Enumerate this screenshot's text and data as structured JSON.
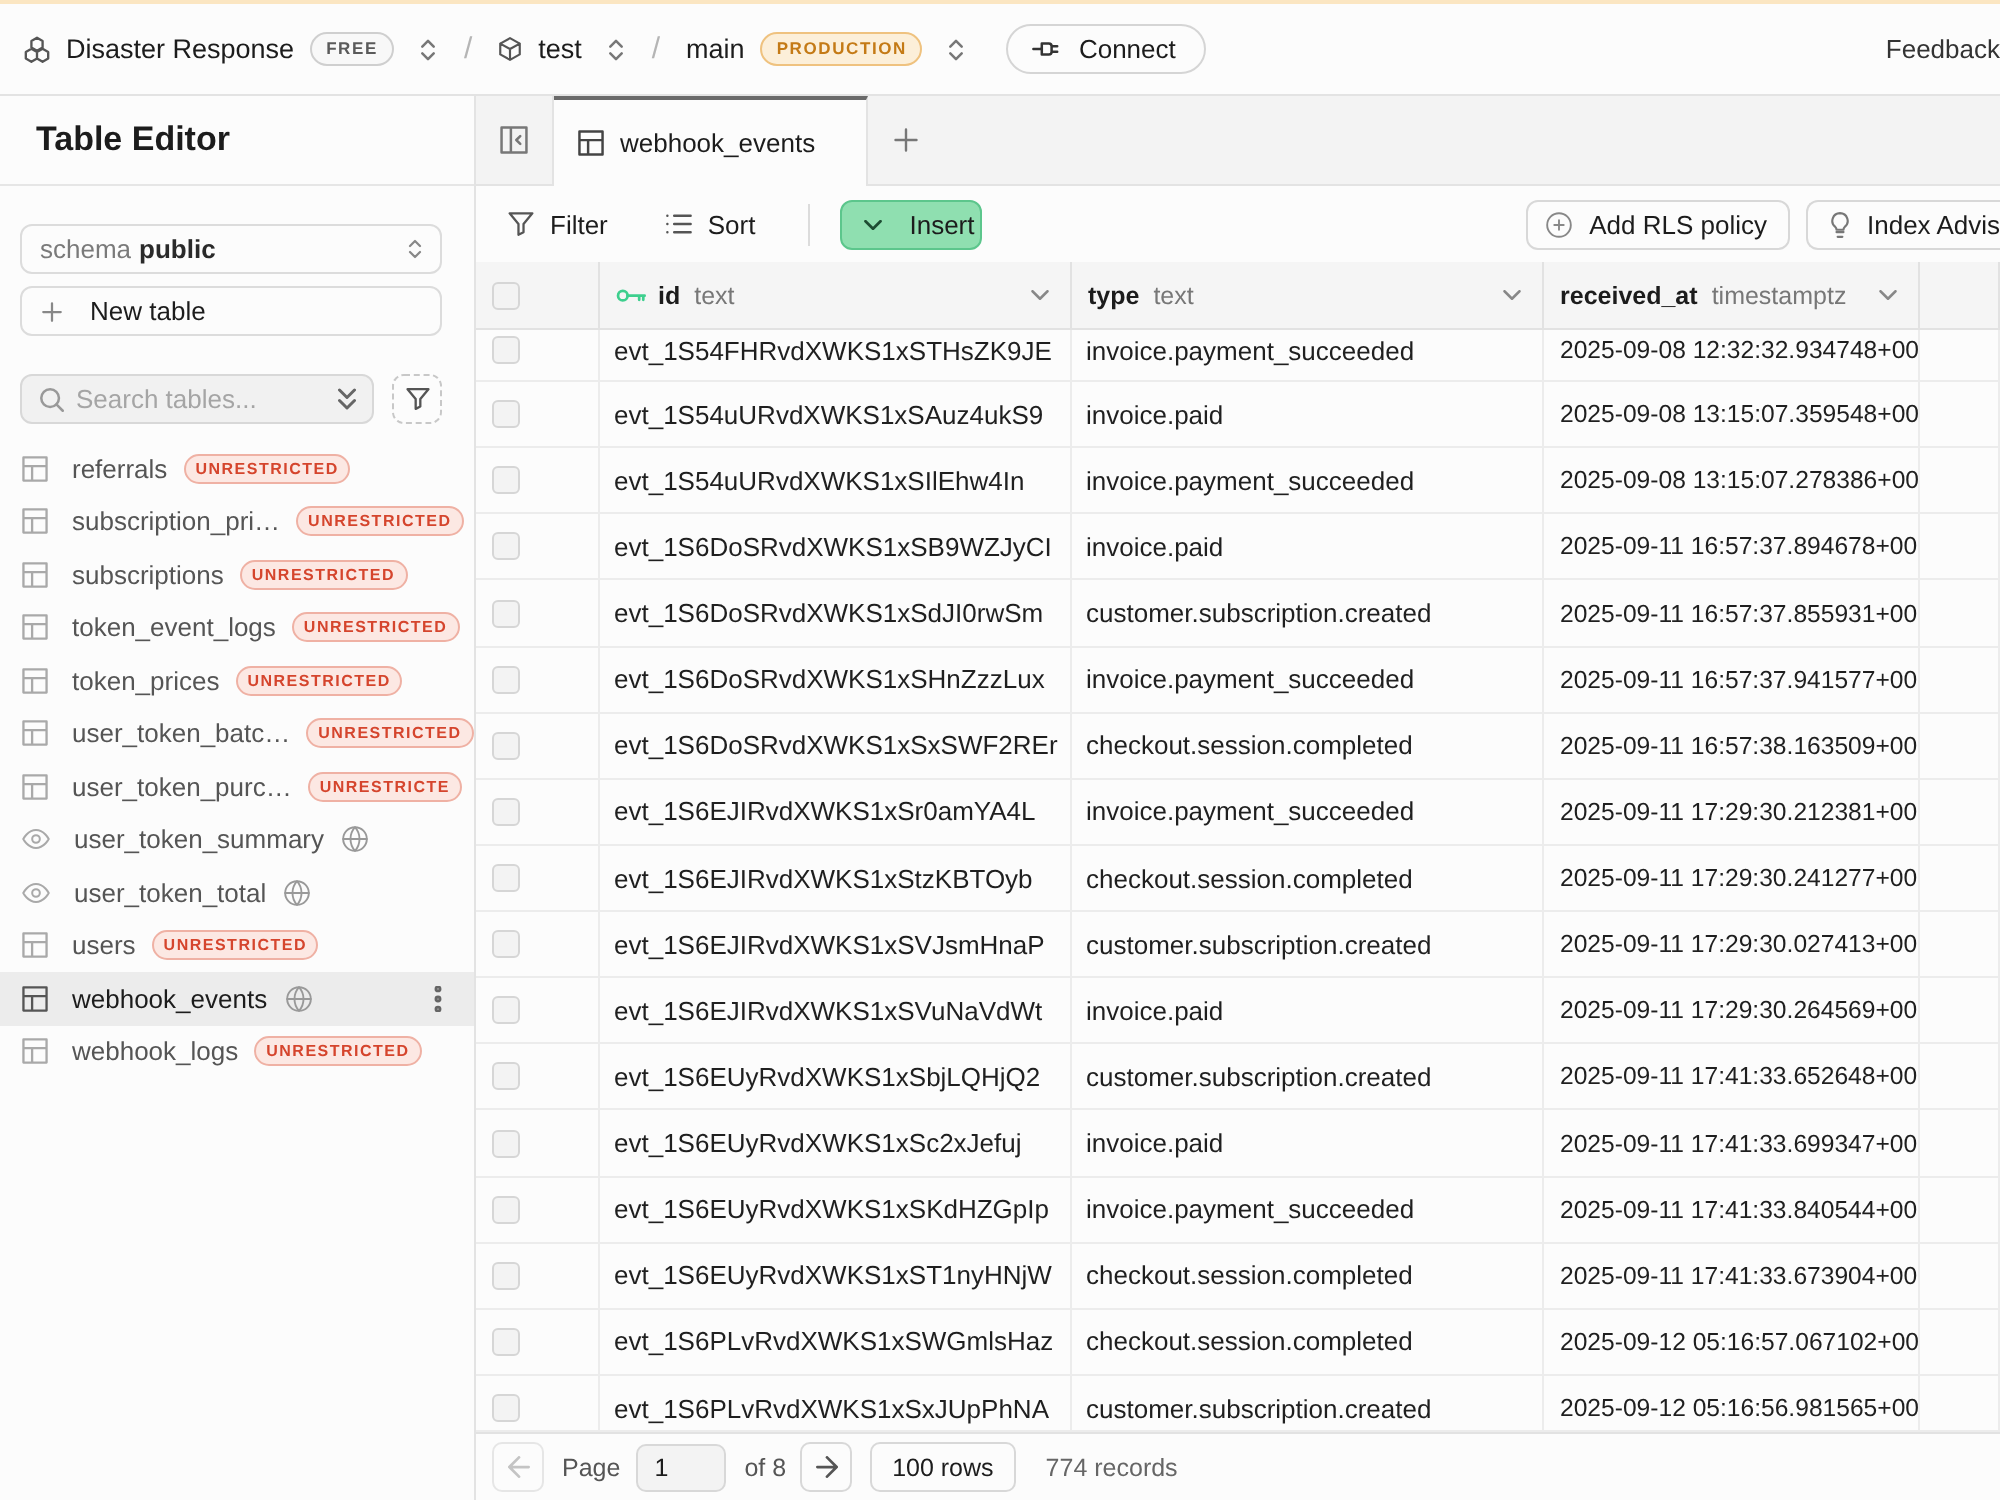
{
  "top_bar": {
    "breadcrumbs": [
      {
        "kind": "org",
        "name": "Disaster Response",
        "badge": "FREE"
      },
      {
        "kind": "project",
        "separator": "/",
        "name": "test"
      },
      {
        "kind": "branch",
        "separator": "/",
        "name": "main",
        "badge": "PRODUCTION"
      }
    ],
    "connect_button": "Connect",
    "feedback_button": "Feedback"
  },
  "sidebar": {
    "title": "Table Editor",
    "schema_select": {
      "label": "schema",
      "value": "public"
    },
    "new_table_button": "New table",
    "search": {
      "placeholder": "Search tables..."
    },
    "tables": [
      {
        "name": "referrals",
        "kind": "table",
        "badge": {
          "kind": "label",
          "text": "UNRESTRICTED"
        },
        "selected": false
      },
      {
        "name": "subscription_pri…",
        "kind": "table",
        "badge": {
          "kind": "label",
          "text": "UNRESTRICTED"
        },
        "selected": false
      },
      {
        "name": "subscriptions",
        "kind": "table",
        "badge": {
          "kind": "label",
          "text": "UNRESTRICTED"
        },
        "selected": false
      },
      {
        "name": "token_event_logs",
        "kind": "table",
        "badge": {
          "kind": "label",
          "text": "UNRESTRICTED"
        },
        "selected": false
      },
      {
        "name": "token_prices",
        "kind": "table",
        "badge": {
          "kind": "label",
          "text": "UNRESTRICTED"
        },
        "selected": false
      },
      {
        "name": "user_token_batc…",
        "kind": "table",
        "badge": {
          "kind": "label",
          "text": "UNRESTRICTED"
        },
        "selected": false
      },
      {
        "name": "user_token_purc…",
        "kind": "table",
        "badge": {
          "kind": "label",
          "text": "UNRESTRICTE"
        },
        "selected": false
      },
      {
        "name": "user_token_summary",
        "kind": "view",
        "badge": {
          "kind": "globe"
        },
        "selected": false
      },
      {
        "name": "user_token_total",
        "kind": "view",
        "badge": {
          "kind": "globe"
        },
        "selected": false
      },
      {
        "name": "users",
        "kind": "table",
        "badge": {
          "kind": "label",
          "text": "UNRESTRICTED"
        },
        "selected": false
      },
      {
        "name": "webhook_events",
        "kind": "table",
        "badge": {
          "kind": "globe"
        },
        "selected": true
      },
      {
        "name": "webhook_logs",
        "kind": "table",
        "badge": {
          "kind": "label",
          "text": "UNRESTRICTED"
        },
        "selected": false
      }
    ]
  },
  "tabs": [
    {
      "label": "webhook_events",
      "selected": true
    }
  ],
  "toolbar": {
    "filter_button": "Filter",
    "sort_button": "Sort",
    "insert_button": "Insert",
    "rls_button": "Add RLS policy",
    "index_button": "Index Advis"
  },
  "table": {
    "select_all_checked": false,
    "columns": [
      {
        "name": "id",
        "type": "text",
        "primary_key": true
      },
      {
        "name": "type",
        "type": "text",
        "primary_key": false
      },
      {
        "name": "received_at",
        "type": "timestamptz",
        "primary_key": false
      }
    ],
    "rows": [
      {
        "checked": false,
        "cells": [
          "evt_1S54FHRvdXWKS1xSTHsZK9JE",
          "invoice.payment_succeeded",
          "2025-09-08 12:32:32.934748+00"
        ]
      },
      {
        "checked": false,
        "cells": [
          "evt_1S54uURvdXWKS1xSAuz4ukS9",
          "invoice.paid",
          "2025-09-08 13:15:07.359548+00"
        ]
      },
      {
        "checked": false,
        "cells": [
          "evt_1S54uURvdXWKS1xSIlEhw4In",
          "invoice.payment_succeeded",
          "2025-09-08 13:15:07.278386+00"
        ]
      },
      {
        "checked": false,
        "cells": [
          "evt_1S6DoSRvdXWKS1xSB9WZJyCI",
          "invoice.paid",
          "2025-09-11 16:57:37.894678+00"
        ]
      },
      {
        "checked": false,
        "cells": [
          "evt_1S6DoSRvdXWKS1xSdJI0rwSm",
          "customer.subscription.created",
          "2025-09-11 16:57:37.855931+00"
        ]
      },
      {
        "checked": false,
        "cells": [
          "evt_1S6DoSRvdXWKS1xSHnZzzLux",
          "invoice.payment_succeeded",
          "2025-09-11 16:57:37.941577+00"
        ]
      },
      {
        "checked": false,
        "cells": [
          "evt_1S6DoSRvdXWKS1xSxSWF2REr",
          "checkout.session.completed",
          "2025-09-11 16:57:38.163509+00"
        ]
      },
      {
        "checked": false,
        "cells": [
          "evt_1S6EJIRvdXWKS1xSr0amYA4L",
          "invoice.payment_succeeded",
          "2025-09-11 17:29:30.212381+00"
        ]
      },
      {
        "checked": false,
        "cells": [
          "evt_1S6EJIRvdXWKS1xStzKBTOyb",
          "checkout.session.completed",
          "2025-09-11 17:29:30.241277+00"
        ]
      },
      {
        "checked": false,
        "cells": [
          "evt_1S6EJIRvdXWKS1xSVJsmHnaP",
          "customer.subscription.created",
          "2025-09-11 17:29:30.027413+00"
        ]
      },
      {
        "checked": false,
        "cells": [
          "evt_1S6EJIRvdXWKS1xSVuNaVdWt",
          "invoice.paid",
          "2025-09-11 17:29:30.264569+00"
        ]
      },
      {
        "checked": false,
        "cells": [
          "evt_1S6EUyRvdXWKS1xSbjLQHjQ2",
          "customer.subscription.created",
          "2025-09-11 17:41:33.652648+00"
        ]
      },
      {
        "checked": false,
        "cells": [
          "evt_1S6EUyRvdXWKS1xSc2xJefuj",
          "invoice.paid",
          "2025-09-11 17:41:33.699347+00"
        ]
      },
      {
        "checked": false,
        "cells": [
          "evt_1S6EUyRvdXWKS1xSKdHZGpIp",
          "invoice.payment_succeeded",
          "2025-09-11 17:41:33.840544+00"
        ]
      },
      {
        "checked": false,
        "cells": [
          "evt_1S6EUyRvdXWKS1xST1nyHNjW",
          "checkout.session.completed",
          "2025-09-11 17:41:33.673904+00"
        ]
      },
      {
        "checked": false,
        "cells": [
          "evt_1S6PLvRvdXWKS1xSWGmlsHaz",
          "checkout.session.completed",
          "2025-09-12 05:16:57.067102+00"
        ]
      },
      {
        "checked": false,
        "cells": [
          "evt_1S6PLvRvdXWKS1xSxJUpPhNA",
          "customer.subscription.created",
          "2025-09-12 05:16:56.981565+00"
        ]
      }
    ]
  },
  "pagination": {
    "prev_button": {
      "disabled": true
    },
    "page_label": "Page",
    "page": "1",
    "page_count": "of 8",
    "next_button": {
      "disabled": false
    },
    "rows_per_page": "100 rows",
    "records": "774 records"
  }
}
